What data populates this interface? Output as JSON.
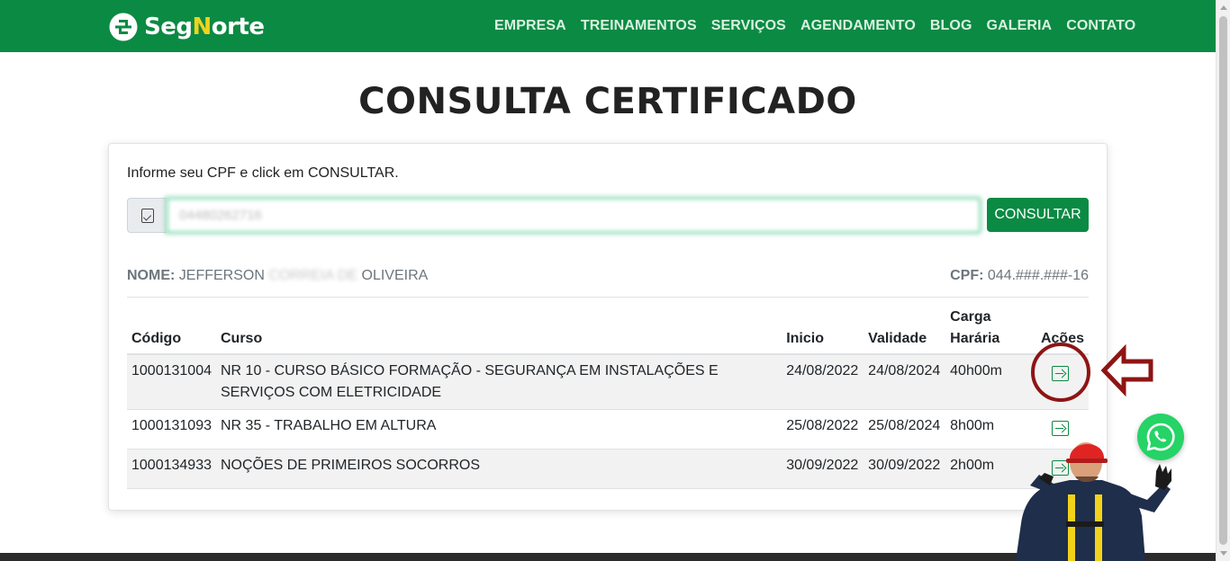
{
  "brand": {
    "logo_seg": "Seg",
    "logo_n": "N",
    "logo_orte": "orte",
    "primary_color": "#0b8a43",
    "accent_color": "#f2d21b"
  },
  "nav": {
    "items": [
      "EMPRESA",
      "TREINAMENTOS",
      "SERVIÇOS",
      "AGENDAMENTO",
      "BLOG",
      "GALERIA",
      "CONTATO"
    ]
  },
  "page": {
    "title": "CONSULTA CERTIFICADO"
  },
  "form": {
    "instruction": "Informe seu CPF e click em CONSULTAR.",
    "cpf_value": "04480262716",
    "button_label": "CONSULTAR"
  },
  "person": {
    "name_label": "NOME:",
    "name_first": "JEFFERSON",
    "name_hidden": "CORREIA DE",
    "name_last": "OLIVEIRA",
    "cpf_label": "CPF:",
    "cpf_value": "044.###.###-16"
  },
  "table": {
    "headers": {
      "code": "Código",
      "course": "Curso",
      "start": "Inicio",
      "validity": "Validade",
      "hours": "Carga Harária",
      "actions": "Ações"
    },
    "rows": [
      {
        "code": "1000131004",
        "course": "NR 10 - CURSO BÁSICO FORMAÇÃO - SEGURANÇA EM INSTALAÇÕES E SERVIÇOS COM ELETRICIDADE",
        "start": "24/08/2022",
        "validity": "24/08/2024",
        "hours": "40h00m",
        "action_icon": "arrow-right-square-icon"
      },
      {
        "code": "1000131093",
        "course": "NR 35 - TRABALHO EM ALTURA",
        "start": "25/08/2022",
        "validity": "25/08/2024",
        "hours": "8h00m",
        "action_icon": "arrow-right-square-icon"
      },
      {
        "code": "1000134933",
        "course": "NOÇÕES DE PRIMEIROS SOCORROS",
        "start": "30/09/2022",
        "validity": "30/09/2022",
        "hours": "2h00m",
        "action_icon": "arrow-right-square-icon"
      }
    ]
  },
  "annotation": {
    "color": "#8f1414"
  },
  "floating": {
    "whatsapp_icon": "whatsapp-icon",
    "whatsapp_color": "#25d366"
  }
}
